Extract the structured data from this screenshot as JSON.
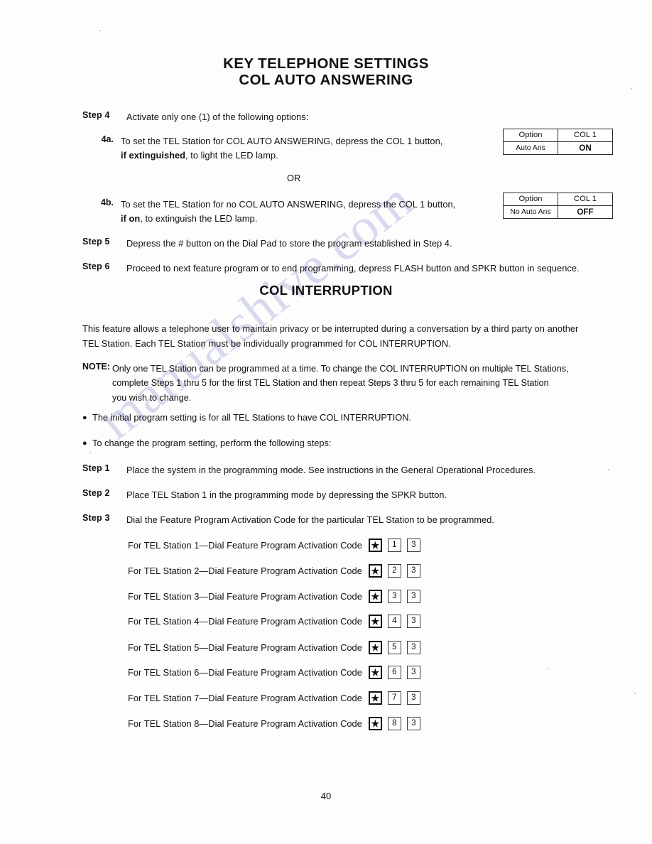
{
  "document": {
    "title_line1": "KEY TELEPHONE SETTINGS",
    "title_line2": "COL AUTO ANSWERING",
    "page_number": "40",
    "watermark": "manualshive.com"
  },
  "auto_answering": {
    "step4": {
      "label": "Step 4",
      "text": "Activate only one (1) of the following options:"
    },
    "step4a": {
      "label": "4a.",
      "line1": "To set the TEL Station for COL AUTO ANSWERING, depress the COL 1 button,",
      "line2_bold": "if extinguished",
      "line2_rest": ", to light the LED lamp."
    },
    "or_divider": "OR",
    "step4b": {
      "label": "4b.",
      "line1": "To set the TEL Station for no COL AUTO ANSWERING, depress the COL 1 button,",
      "line2_bold": "if on",
      "line2_rest": ", to extinguish the LED lamp."
    },
    "step5": {
      "label": "Step 5",
      "text": "Depress the # button on the Dial Pad to store the program established in Step 4."
    },
    "step6": {
      "label": "Step 6",
      "text": "Proceed to next feature program or to end programming, depress FLASH button and SPKR button in sequence."
    },
    "table_on": {
      "header_left": "Option",
      "header_right": "COL 1",
      "value_left": "Auto Ans",
      "value_right": "ON"
    },
    "table_off": {
      "header_left": "Option",
      "header_right": "COL 1",
      "value_left": "No Auto Ans",
      "value_right": "OFF"
    }
  },
  "interruption": {
    "section_title": "COL INTERRUPTION",
    "intro_line1": "This feature allows a telephone user to maintain privacy or be interrupted during a conversation by a third party on another",
    "intro_line2": "TEL Station. Each TEL Station must be individually programmed for COL INTERRUPTION.",
    "note": {
      "label": "NOTE:",
      "line1": "Only one TEL Station can be programmed at a time. To change the COL INTERRUPTION on multiple TEL Stations,",
      "line2": "complete Steps 1 thru 5 for the first TEL Station and then repeat Steps 3 thru 5 for each remaining TEL Station",
      "line3": "you wish to change."
    },
    "bullets": [
      "The initial program setting is for all TEL Stations to have COL INTERRUPTION.",
      "To change the program setting, perform the following steps:"
    ],
    "bullet_glyph": "●",
    "step1": {
      "label": "Step 1",
      "text": "Place the system in the programming mode. See instructions in the General Operational Procedures."
    },
    "step2": {
      "label": "Step 2",
      "text": "Place TEL Station 1 in the programming mode by depressing the SPKR button."
    },
    "step3": {
      "label": "Step 3",
      "text": "Dial the Feature Program Activation Code for the particular TEL Station to be programmed."
    },
    "star_glyph": "★",
    "activation_codes": [
      {
        "text": "For TEL Station 1—Dial Feature Program Activation Code",
        "key1": "★",
        "key2": "1",
        "key3": "3"
      },
      {
        "text": "For TEL Station 2—Dial Feature Program Activation Code",
        "key1": "★",
        "key2": "2",
        "key3": "3"
      },
      {
        "text": "For TEL Station 3—Dial Feature Program Activation Code",
        "key1": "★",
        "key2": "3",
        "key3": "3"
      },
      {
        "text": "For TEL Station 4—Dial Feature Program Activation Code",
        "key1": "★",
        "key2": "4",
        "key3": "3"
      },
      {
        "text": "For TEL Station 5—Dial Feature Program Activation Code",
        "key1": "★",
        "key2": "5",
        "key3": "3"
      },
      {
        "text": "For TEL Station 6—Dial Feature Program Activation Code",
        "key1": "★",
        "key2": "6",
        "key3": "3"
      },
      {
        "text": "For TEL Station 7—Dial Feature Program Activation Code",
        "key1": "★",
        "key2": "7",
        "key3": "3"
      },
      {
        "text": "For TEL Station 8—Dial Feature Program Activation Code",
        "key1": "★",
        "key2": "8",
        "key3": "3"
      }
    ]
  }
}
